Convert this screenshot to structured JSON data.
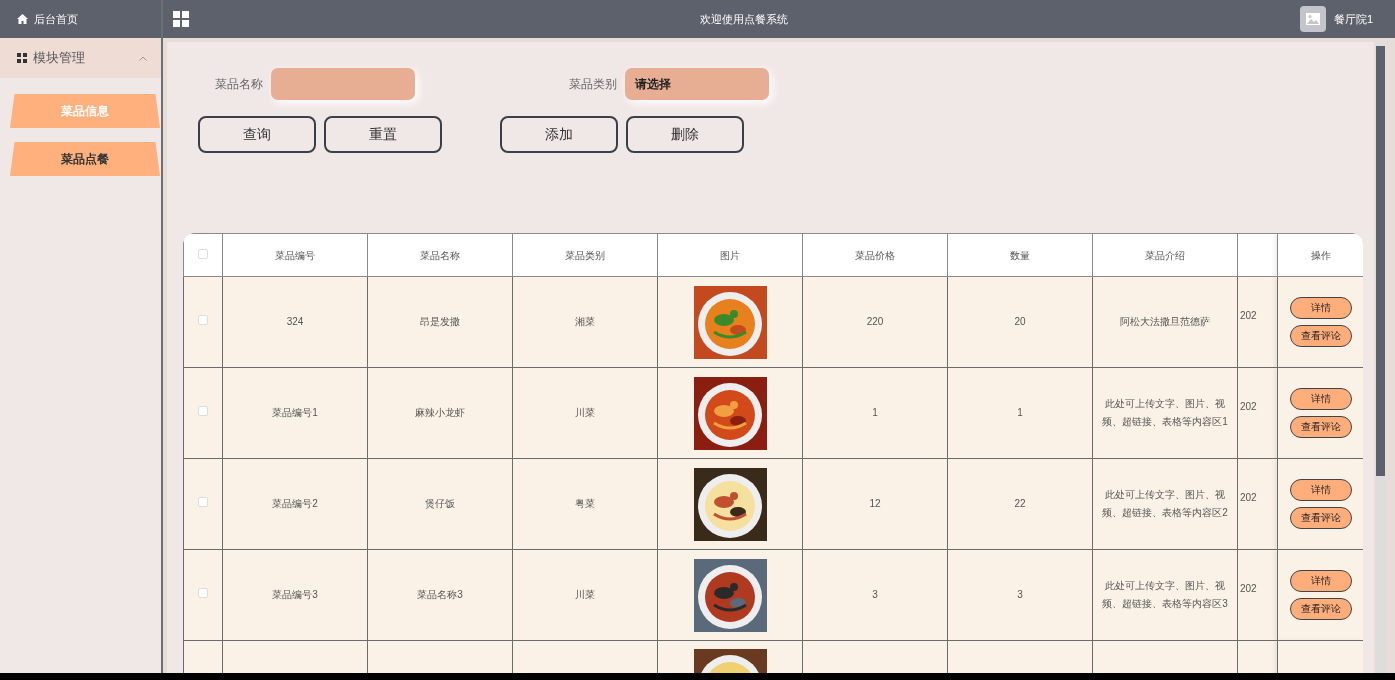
{
  "header": {
    "home": "后台首页",
    "title": "欢迎使用点餐系统",
    "user": "餐厅院1"
  },
  "sidebar": {
    "group": {
      "label": "模块管理",
      "expanded": true
    },
    "items": [
      {
        "label": "菜品信息",
        "selected": true
      },
      {
        "label": "菜品点餐",
        "selected": false
      }
    ]
  },
  "filters": [
    {
      "label": "菜品名称",
      "kind": "text"
    },
    {
      "label": "菜品类别",
      "kind": "select",
      "value": "请选择"
    }
  ],
  "buttons": [
    [
      "查询",
      "重置"
    ],
    [
      "添加",
      "删除"
    ]
  ],
  "table": {
    "columns": [
      "菜品编号",
      "菜品名称",
      "菜品类别",
      "图片",
      "菜品价格",
      "数量",
      "菜品介绍"
    ],
    "action_column": "操作",
    "all_checked": false,
    "rows": [
      {
        "checked": false,
        "cells": [
          "324",
          "昂是发撒",
          "湘菜",
          "",
          "220",
          "20",
          "阿松大法撒旦范德萨"
        ],
        "column_9": "202",
        "actions": [
          "详情",
          "查看评论"
        ]
      },
      {
        "checked": false,
        "cells": [
          "菜品编号1",
          "麻辣小龙虾",
          "川菜",
          "",
          "1",
          "1",
          "此处可上传文字、图片、视频、超链接、表格等内容区1"
        ],
        "column_9": "202",
        "actions": [
          "详情",
          "查看评论"
        ]
      },
      {
        "checked": false,
        "cells": [
          "菜品编号2",
          "煲仔饭",
          "粤菜",
          "",
          "12",
          "22",
          "此处可上传文字、图片、视频、超链接、表格等内容区2"
        ],
        "column_9": "202",
        "actions": [
          "详情",
          "查看评论"
        ]
      },
      {
        "checked": false,
        "cells": [
          "菜品编号3",
          "菜品名称3",
          "川菜",
          "",
          "3",
          "3",
          "此处可上传文字、图片、视频、超链接、表格等内容区3"
        ],
        "column_9": "202",
        "actions": [
          "详情",
          "查看评论"
        ]
      },
      {
        "kind": "partial"
      }
    ]
  }
}
